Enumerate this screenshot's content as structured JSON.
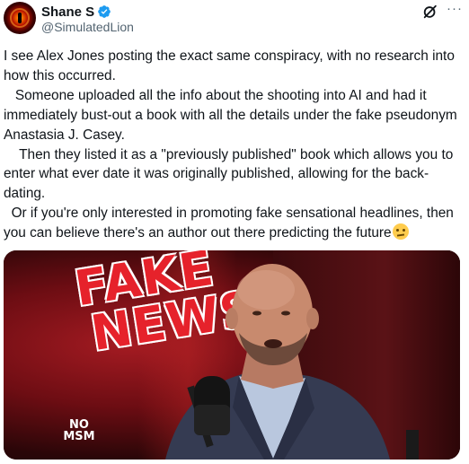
{
  "author": {
    "display_name": "Shane S",
    "handle": "@SimulatedLion",
    "verified": true,
    "avatar_icon": "red-eye-avatar"
  },
  "header_actions": {
    "grok_icon": "grok-slash-icon",
    "more_icon": "more-dots-icon",
    "more_glyph": "···"
  },
  "tweet": {
    "paragraphs": [
      "I see Alex Jones posting the exact same conspiracy, with no research into how this occurred.",
      "   Someone uploaded all the info about the shooting into AI and had it immediately bust-out a book with all the details under the fake pseudonym Anastasia J. Casey.",
      "    Then they listed it as a \"previously published\" book which allows you to enter what ever date it was originally published, allowing for the back-dating.",
      "  Or if you're only interested in promoting fake sensational headlines, then you can believe there's an author out there predicting the future"
    ],
    "trailing_emoji": "thinking-face-emoji"
  },
  "media": {
    "overlay_line1": "FAKE",
    "overlay_line2": "NEWS",
    "logo_line1": "NO",
    "logo_line2": "MSM",
    "colors": {
      "fake_news_red": "#e6222b",
      "background_red": "#6d0d13"
    }
  },
  "colors": {
    "verified_blue": "#1d9bf0",
    "secondary_text": "#536471",
    "primary_text": "#0f1419"
  }
}
